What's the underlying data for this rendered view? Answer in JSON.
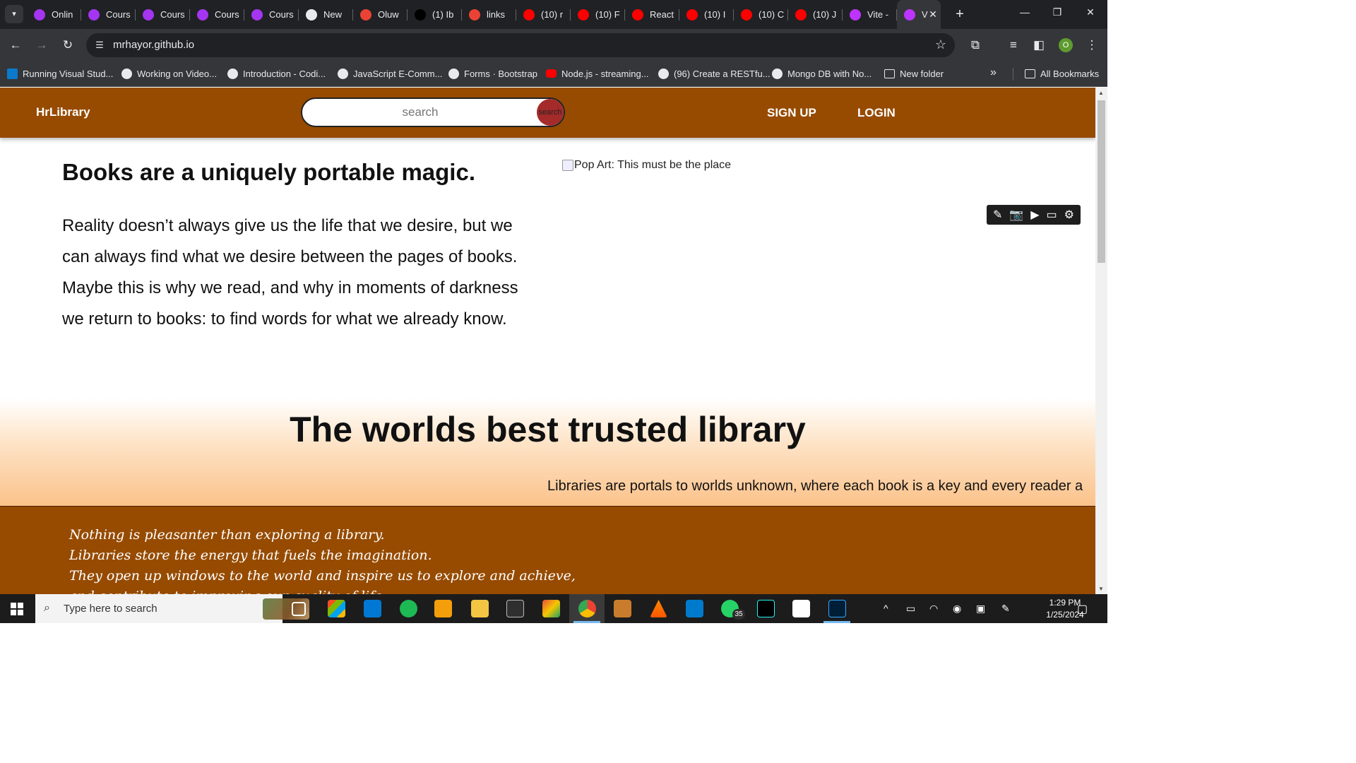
{
  "browser": {
    "tabs": [
      {
        "label": "Onlin",
        "icon": "udemy-icon",
        "color": "#a435f0"
      },
      {
        "label": "Cours",
        "icon": "udemy-icon",
        "color": "#a435f0"
      },
      {
        "label": "Cours",
        "icon": "udemy-icon",
        "color": "#a435f0"
      },
      {
        "label": "Cours",
        "icon": "udemy-icon",
        "color": "#a435f0"
      },
      {
        "label": "Cours",
        "icon": "udemy-icon",
        "color": "#a435f0"
      },
      {
        "label": "New",
        "icon": "globe-icon",
        "color": "#e8eaed"
      },
      {
        "label": "Oluw",
        "icon": "gmail-icon",
        "color": "#ea4335"
      },
      {
        "label": "(1) Ib",
        "icon": "x-icon",
        "color": "#000000"
      },
      {
        "label": "links",
        "icon": "gmail-icon",
        "color": "#ea4335"
      },
      {
        "label": "(10) r",
        "icon": "youtube-icon",
        "color": "#ff0000"
      },
      {
        "label": "(10) F",
        "icon": "youtube-icon",
        "color": "#ff0000"
      },
      {
        "label": "React",
        "icon": "youtube-icon",
        "color": "#ff0000"
      },
      {
        "label": "(10) I",
        "icon": "youtube-icon",
        "color": "#ff0000"
      },
      {
        "label": "(10) C",
        "icon": "youtube-icon",
        "color": "#ff0000"
      },
      {
        "label": "(10) J",
        "icon": "youtube-icon",
        "color": "#ff0000"
      },
      {
        "label": "Vite -",
        "icon": "vite-icon",
        "color": "#bd34fe"
      },
      {
        "label": "V",
        "icon": "vite-icon",
        "color": "#bd34fe",
        "active": true
      }
    ],
    "url": "mrhayor.github.io",
    "profile_initial": "O",
    "bookmarks": [
      {
        "label": "Running Visual Stud...",
        "icon": "vscode-icon"
      },
      {
        "label": "Working on Video...",
        "icon": "globe-icon"
      },
      {
        "label": "Introduction - Codi...",
        "icon": "globe-icon"
      },
      {
        "label": "JavaScript E-Comm...",
        "icon": "globe-icon"
      },
      {
        "label": "Forms · Bootstrap",
        "icon": "globe-icon"
      },
      {
        "label": "Node.js - streaming...",
        "icon": "youtube-icon"
      },
      {
        "label": "(96) Create a RESTfu...",
        "icon": "globe-icon"
      },
      {
        "label": "Mongo DB with No...",
        "icon": "globe-icon"
      },
      {
        "label": "New folder",
        "icon": "folder-icon"
      }
    ],
    "all_bookmarks_label": "All Bookmarks"
  },
  "site": {
    "brand": "HrLibrary",
    "search_placeholder": "search",
    "search_button": "search",
    "signup": "SIGN UP",
    "login": "LOGIN",
    "hero_title": "Books are a uniquely portable magic.",
    "hero_text": "Reality doesn’t always give us the life that we desire, but we can always find what we desire between the pages of books. Maybe this is why we read, and why in moments of darkness we return to books: to find words for what we already know.",
    "hero_image_alt": "Pop Art: This must be the place",
    "section_title": "The worlds best trusted library",
    "marquee": "Libraries are portals to worlds unknown, where each book is a key and every reader a",
    "quote_lines": [
      "Nothing is pleasanter than exploring a library.",
      "Libraries store the energy that fuels the imagination.",
      "They open up windows to the world and inspire us to explore and achieve,",
      "and contribute to improving our quality of life."
    ]
  },
  "colors": {
    "nav_brown": "#964b00",
    "search_button_red": "#a52a2a",
    "gradient_orange": "#fbbf85"
  },
  "taskbar": {
    "search_placeholder": "Type here to search",
    "whatsapp_badge": "35",
    "time": "1:29 PM",
    "date": "1/25/2024"
  }
}
